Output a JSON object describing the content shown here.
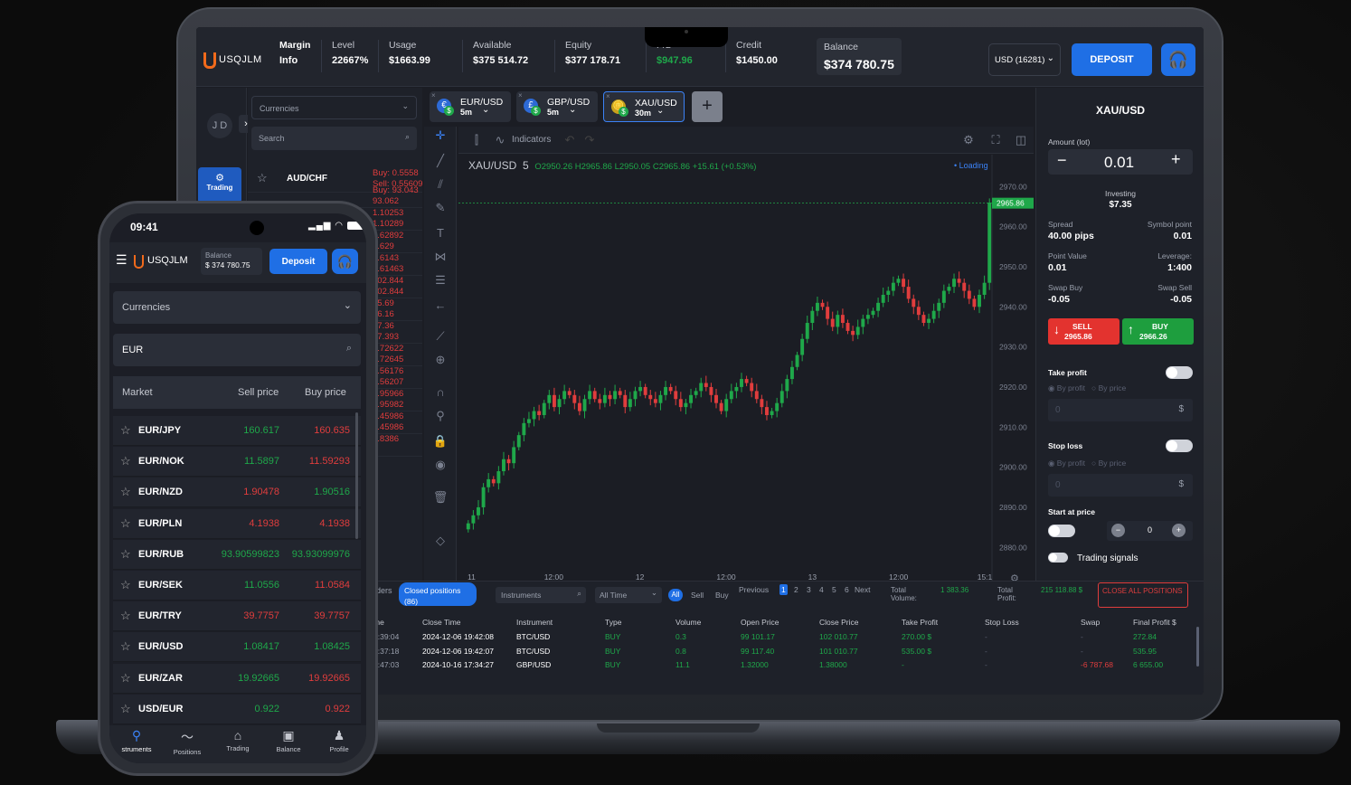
{
  "laptop": {
    "brand": "USQJLM",
    "stats": [
      {
        "label": "Margin",
        "value": "Info"
      },
      {
        "label": "Level",
        "value": "22667%"
      },
      {
        "label": "Usage",
        "value": "$1663.99"
      },
      {
        "label": "Available",
        "value": "$375 514.72"
      },
      {
        "label": "Equity",
        "value": "$377 178.71"
      },
      {
        "label": "P/L",
        "value": "$947.96"
      },
      {
        "label": "Credit",
        "value": "$1450.00"
      },
      {
        "label": "Balance",
        "value": "$374 780.75"
      }
    ],
    "currency_select": "USD (16281)",
    "deposit_label": "DEPOSIT",
    "avatar": "J D",
    "trading_label": "Trading",
    "currencies_placeholder": "Currencies",
    "search_placeholder": "Search",
    "list": [
      {
        "name": "AUD/CHF",
        "buy": "Buy: 0.5558",
        "sell": "Sell: 0.55609"
      },
      {
        "buy": "Buy: 93.043",
        "sell": "93.062"
      },
      {
        "buy": "1.10253",
        "sell": "1.10289"
      },
      {
        "buy": "0.62892",
        "sell": "0.629"
      },
      {
        "buy": "0.6143",
        "sell": "0.61463"
      },
      {
        "buy": "102.844",
        "sell": "102.844"
      },
      {
        "buy": "15.69",
        "sell": "16.16"
      },
      {
        "buy": "37.36",
        "sell": "37.393"
      },
      {
        "buy": "1.72622",
        "sell": "1.72645"
      },
      {
        "buy": "1.56176",
        "sell": "1.56207"
      },
      {
        "buy": "1.95966",
        "sell": "1.95982"
      },
      {
        "buy": "1.45986",
        "sell": "1.45986"
      },
      {
        "buy": "0.8386",
        "sell": ""
      }
    ],
    "tabs": [
      {
        "pair": "EUR/USD",
        "tf": "5m"
      },
      {
        "pair": "GBP/USD",
        "tf": "5m"
      },
      {
        "pair": "XAU/USD",
        "tf": "30m"
      }
    ],
    "add_tab": "+",
    "indicators_label": "Indicators",
    "chart_header": {
      "symbol": "XAU/USD",
      "interval": "5",
      "o": "O2950.26",
      "h": "H2965.86",
      "l": "L2950.05",
      "c": "C2965.86",
      "chg": "+15.61 (+0.53%)",
      "loading": "• Loading"
    },
    "price_tag": "2965.86",
    "right": {
      "symbol": "XAU/USD",
      "amount_label": "Amount (lot)",
      "amount": "0.01",
      "investing_label": "Investing",
      "investing": "$7.35",
      "spread_label": "Spread",
      "spread": "40.00 pips",
      "symbol_point_label": "Symbol point",
      "symbol_point": "0.01",
      "point_value_label": "Point Value",
      "point_value": "0.01",
      "leverage_label": "Leverage:",
      "leverage": "1:400",
      "swap_buy_label": "Swap Buy",
      "swap_buy": "-0.05",
      "swap_sell_label": "Swap Sell",
      "swap_sell": "-0.05",
      "sell_label": "SELL",
      "sell_price": "2965.86",
      "buy_label": "BUY",
      "buy_price": "2966.26",
      "take_profit": "Take profit",
      "by_profit": "By profit",
      "by_price": "By price",
      "zero": "0",
      "dollar": "$",
      "stop_loss": "Stop loss",
      "start_at_price": "Start at price",
      "stepper_val": "0",
      "trading_signals": "Trading signals"
    },
    "bottom": {
      "orders_tab": "rders",
      "closed_tab": "Closed positions",
      "closed_count": "(86)",
      "instruments_placeholder": "Instruments",
      "all_time": "All Time",
      "filters": [
        "All",
        "Sell",
        "Buy"
      ],
      "previous": "Previous",
      "pages": [
        "1",
        "2",
        "3",
        "4",
        "5",
        "6"
      ],
      "next": "Next",
      "total_volume_label": "Total Volume:",
      "total_volume": "1 383.36",
      "total_profit_label": "Total Profit:",
      "total_profit": "215 118.88 $",
      "close_all": "CLOSE ALL POSITIONS",
      "columns": [
        "me",
        "Close Time",
        "Instrument",
        "Type",
        "Volume",
        "Open Price",
        "Close Price",
        "Take Profit",
        "Stop Loss",
        "Swap",
        "Final Profit $"
      ],
      "rows": [
        [
          "3:39:04",
          "2024-12-06 19:42:08",
          "BTC/USD",
          "BUY",
          "0.3",
          "99 101.17",
          "102 010.77",
          "270.00 $",
          "-",
          "-",
          "272.84"
        ],
        [
          "3:37:18",
          "2024-12-06 19:42:07",
          "BTC/USD",
          "BUY",
          "0.8",
          "99 117.40",
          "101 010.77",
          "535.00 $",
          "-",
          "-",
          "535.95"
        ],
        [
          "0:47:03",
          "2024-10-16 17:34:27",
          "GBP/USD",
          "BUY",
          "11.1",
          "1.32000",
          "1.38000",
          "-",
          "-",
          "-6 787.68",
          "6 655.00"
        ]
      ]
    }
  },
  "chart_data": {
    "type": "candlestick",
    "symbol": "XAU/USD",
    "interval": "5",
    "x_ticks": [
      "11",
      "12:00",
      "12",
      "12:00",
      "13",
      "12:00",
      "15:1"
    ],
    "y_ticks": [
      2970,
      2960,
      2950,
      2940,
      2930,
      2920,
      2910,
      2900,
      2890,
      2880
    ],
    "ylim": [
      2876,
      2973
    ],
    "last_price": 2965.86,
    "close": [
      2886,
      2888,
      2890,
      2895,
      2897,
      2896,
      2899,
      2902,
      2901,
      2905,
      2908,
      2911,
      2912,
      2914,
      2913,
      2916,
      2918,
      2915,
      2917,
      2919,
      2918,
      2916,
      2914,
      2917,
      2919,
      2917,
      2916,
      2918,
      2917,
      2919,
      2918,
      2915,
      2917,
      2919,
      2920,
      2918,
      2917,
      2916,
      2918,
      2920,
      2919,
      2917,
      2915,
      2916,
      2918,
      2919,
      2921,
      2920,
      2918,
      2916,
      2914,
      2917,
      2919,
      2920,
      2922,
      2921,
      2919,
      2917,
      2915,
      2913,
      2914,
      2916,
      2919,
      2922,
      2925,
      2928,
      2932,
      2936,
      2939,
      2941,
      2940,
      2937,
      2935,
      2938,
      2936,
      2934,
      2933,
      2935,
      2937,
      2938,
      2939,
      2941,
      2943,
      2944,
      2946,
      2947,
      2945,
      2942,
      2940,
      2938,
      2936,
      2937,
      2939,
      2941,
      2944,
      2945,
      2947,
      2946,
      2944,
      2942,
      2940,
      2943,
      2946,
      2966
    ]
  },
  "phone": {
    "time": "09:41",
    "brand": "USQJLM",
    "balance_label": "Balance",
    "balance": "$ 374 780.75",
    "deposit_label": "Deposit",
    "currencies_placeholder": "Currencies",
    "search_value": "EUR",
    "headers": {
      "market": "Market",
      "sell": "Sell price",
      "buy": "Buy price"
    },
    "rows": [
      {
        "name": "EUR/JPY",
        "sell": "160.617",
        "buy": "160.635",
        "sc": "green",
        "bc": "red"
      },
      {
        "name": "EUR/NOK",
        "sell": "11.5897",
        "buy": "11.59293",
        "sc": "green",
        "bc": "red"
      },
      {
        "name": "EUR/NZD",
        "sell": "1.90478",
        "buy": "1.90516",
        "sc": "red",
        "bc": "green"
      },
      {
        "name": "EUR/PLN",
        "sell": "4.1938",
        "buy": "4.1938",
        "sc": "red",
        "bc": "red"
      },
      {
        "name": "EUR/RUB",
        "sell": "93.90599823",
        "buy": "93.93099976",
        "sc": "green",
        "bc": "green"
      },
      {
        "name": "EUR/SEK",
        "sell": "11.0556",
        "buy": "11.0584",
        "sc": "green",
        "bc": "red"
      },
      {
        "name": "EUR/TRY",
        "sell": "39.7757",
        "buy": "39.7757",
        "sc": "red",
        "bc": "red"
      },
      {
        "name": "EUR/USD",
        "sell": "1.08417",
        "buy": "1.08425",
        "sc": "green",
        "bc": "green"
      },
      {
        "name": "EUR/ZAR",
        "sell": "19.92665",
        "buy": "19.92665",
        "sc": "green",
        "bc": "red"
      },
      {
        "name": "USD/EUR",
        "sell": "0.922",
        "buy": "0.922",
        "sc": "green",
        "bc": "red"
      }
    ],
    "nav": [
      "struments",
      "Positions",
      "Trading",
      "Balance",
      "Profile"
    ]
  }
}
